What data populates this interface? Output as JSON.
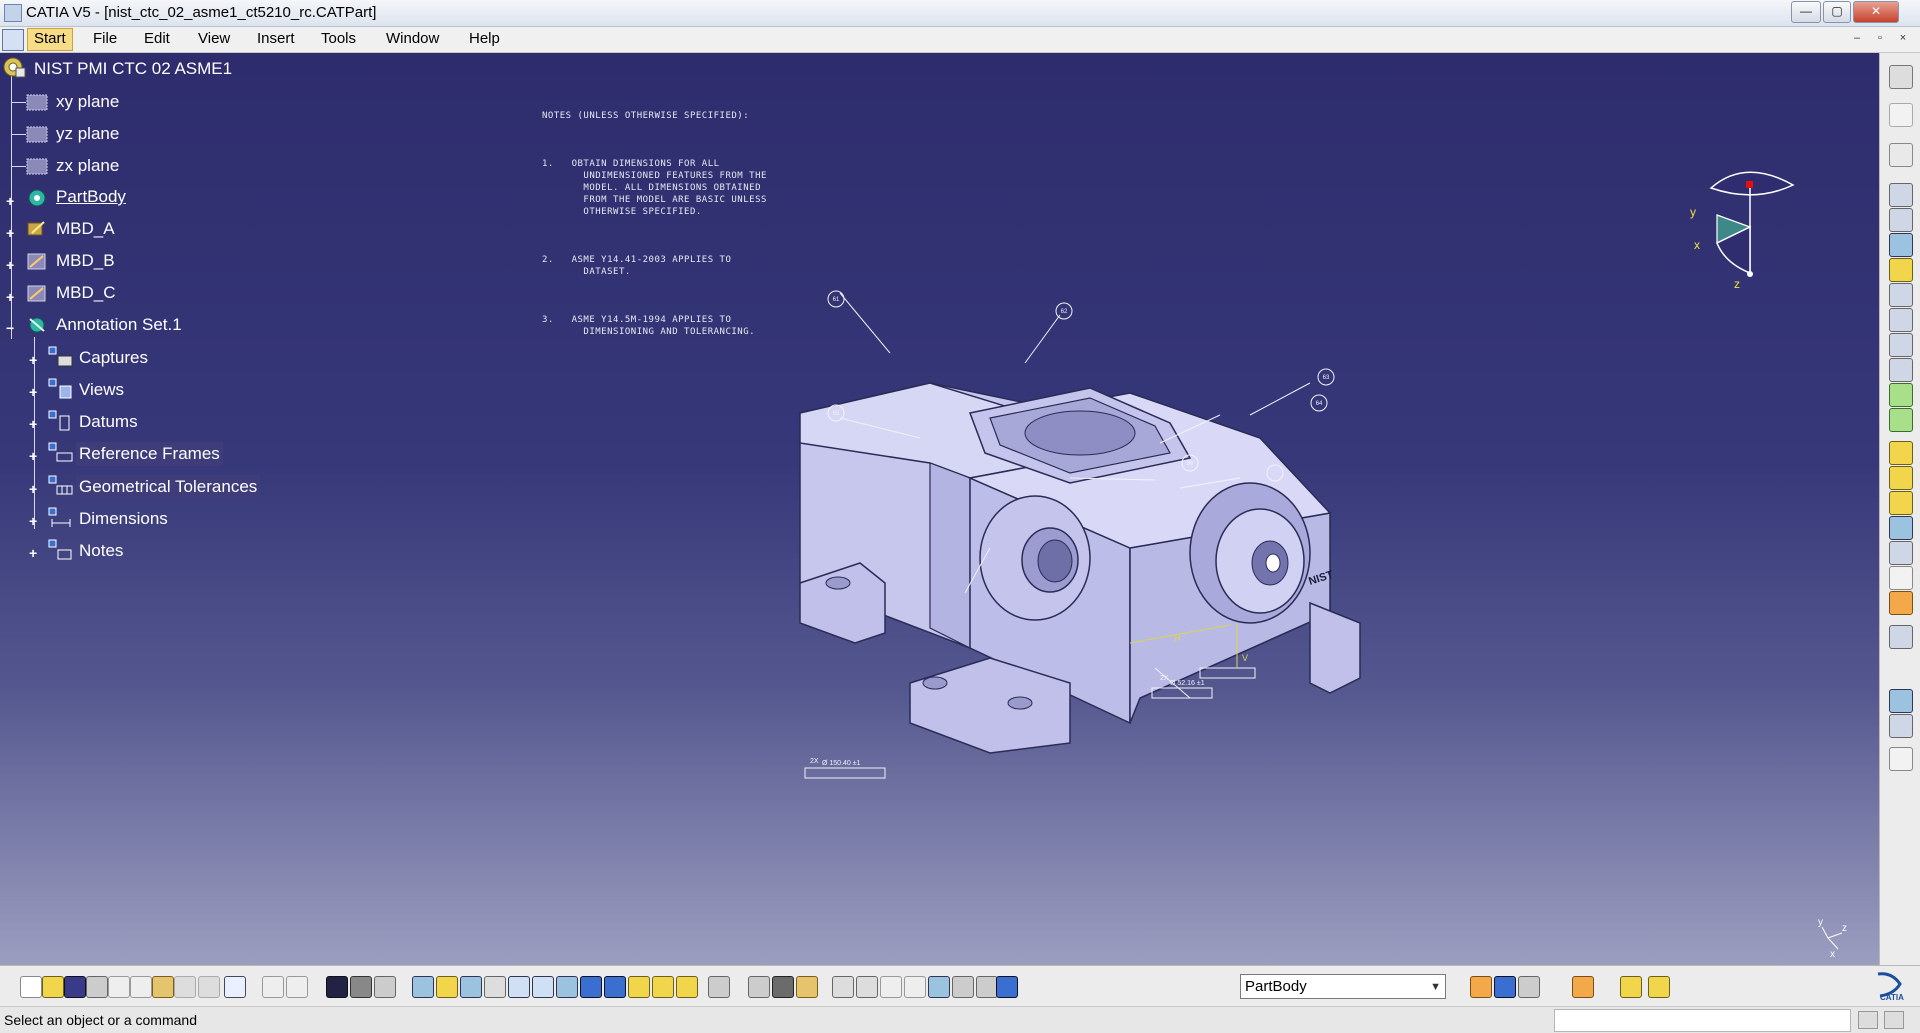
{
  "window": {
    "title": "CATIA V5 - [nist_ctc_02_asme1_ct5210_rc.CATPart]",
    "minimize": "—",
    "maximize": "▢",
    "close": "✕",
    "doc_minimize": "–",
    "doc_restore": "▫",
    "doc_close": "×"
  },
  "menubar": {
    "items": [
      "Start",
      "File",
      "Edit",
      "View",
      "Insert",
      "Tools",
      "Window",
      "Help"
    ]
  },
  "tree": {
    "root": "NIST PMI CTC 02 ASME1",
    "items": [
      "xy plane",
      "yz plane",
      "zx plane",
      "PartBody",
      "MBD_A",
      "MBD_B",
      "MBD_C",
      "Annotation Set.1"
    ],
    "annotation_children": [
      "Captures",
      "Views",
      "Datums",
      "Reference Frames",
      "Geometrical Tolerances",
      "Dimensions",
      "Notes"
    ]
  },
  "notes": {
    "header": "NOTES (UNLESS OTHERWISE SPECIFIED):",
    "n1": "1.   OBTAIN DIMENSIONS FOR ALL\n       UNDIMENSIONED FEATURES FROM THE\n       MODEL. ALL DIMENSIONS OBTAINED\n       FROM THE MODEL ARE BASIC UNLESS\n       OTHERWISE SPECIFIED.",
    "n2": "2.   ASME Y14.41-2003 APPLIES TO\n       DATASET.",
    "n3": "3.   ASME Y14.5M-1994 APPLIES TO\n       DIMENSIONING AND TOLERANCING."
  },
  "compass": {
    "x": "x",
    "y": "y",
    "z": "z"
  },
  "axis_small": {
    "x": "x",
    "y": "y",
    "z": "z"
  },
  "model": {
    "brand_mark": "NIST",
    "dim1_label": "2X",
    "dim1_value": "Ø 150.40 ±1",
    "dim2_label": "2X",
    "dim2_value": "Ø 52.16 ±1",
    "dim3_value": "H",
    "dim4_value": "V",
    "balloon_labels": [
      "61",
      "62",
      "63",
      "64",
      "65",
      "66"
    ]
  },
  "bottom_toolbar": {
    "select_value": "PartBody"
  },
  "status": {
    "message": "Select an object or a command"
  },
  "colors": {
    "tree_text": "#ffffff",
    "menu_active": "#f5dd88",
    "model_fill": "#c8c8ef",
    "model_shadow": "#9696c8",
    "background_top": "#2e2c6d"
  }
}
